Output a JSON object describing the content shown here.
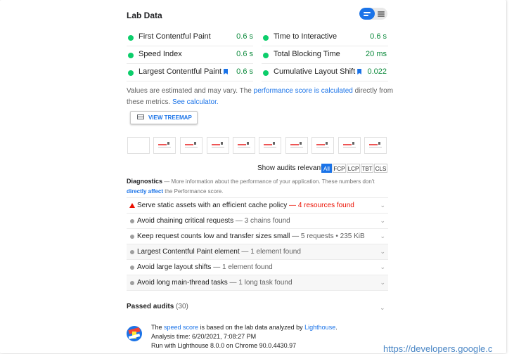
{
  "lab": {
    "title": "Lab Data",
    "metrics_left": [
      {
        "label": "First Contentful Paint",
        "value": "0.6 s"
      },
      {
        "label": "Speed Index",
        "value": "0.6 s"
      },
      {
        "label": "Largest Contentful Paint",
        "value": "0.6 s"
      }
    ],
    "metrics_right": [
      {
        "label": "Time to Interactive",
        "value": "0.6 s"
      },
      {
        "label": "Total Blocking Time",
        "value": "20 ms"
      },
      {
        "label": "Cumulative Layout Shift",
        "value": "0.022"
      }
    ],
    "status_color": "#0cce6b",
    "value_color": "#0c8a3c"
  },
  "note": {
    "text1": "Values are estimated and may vary. The ",
    "link1": "performance score is calculated",
    "text2": " directly from these metrics. ",
    "link2": "See calculator."
  },
  "treemap": {
    "label": "VIEW TREEMAP",
    "icon": "treemap-icon"
  },
  "filter": {
    "label": "Show audits relevant to:",
    "chips": [
      "All",
      "FCP",
      "LCP",
      "TBT",
      "CLS"
    ],
    "active": "All"
  },
  "diagnostics": {
    "title": "Diagnostics",
    "desc1": " — More information about the performance of your application. These numbers don't ",
    "link": "directly affect",
    "desc2": " the Performance score."
  },
  "audits": [
    {
      "title": "Serve static assets with an efficient cache policy",
      "desc": " — 4 resources found",
      "status": "fail"
    },
    {
      "title": "Avoid chaining critical requests",
      "desc": " — 3 chains found",
      "status": "info"
    },
    {
      "title": "Keep request counts low and transfer sizes small",
      "desc": " — 5 requests • 235 KiB",
      "status": "info"
    },
    {
      "title": "Largest Contentful Paint element",
      "desc": " — 1 element found",
      "status": "info"
    },
    {
      "title": "Avoid large layout shifts",
      "desc": " — 1 element found",
      "status": "info"
    },
    {
      "title": "Avoid long main-thread tasks",
      "desc": " — 1 long task found",
      "status": "info"
    }
  ],
  "passed": {
    "label": "Passed audits",
    "count": "(30)"
  },
  "footer": {
    "line1_pre": "The ",
    "line1_link": "speed score",
    "line1_mid": " is based on the lab data analyzed by ",
    "line1_link2": "Lighthouse",
    "line1_end": ".",
    "line2": "Analysis time: 6/20/2021, 7:08:27 PM",
    "line3": "Run with Lighthouse 8.0.0 on Chrome 90.0.4430.97"
  },
  "url_fragment": "https://developers.google.c",
  "colors": {
    "accent": "#1a73e8",
    "fail": "#eb0f00",
    "pass": "#0cce6b"
  }
}
